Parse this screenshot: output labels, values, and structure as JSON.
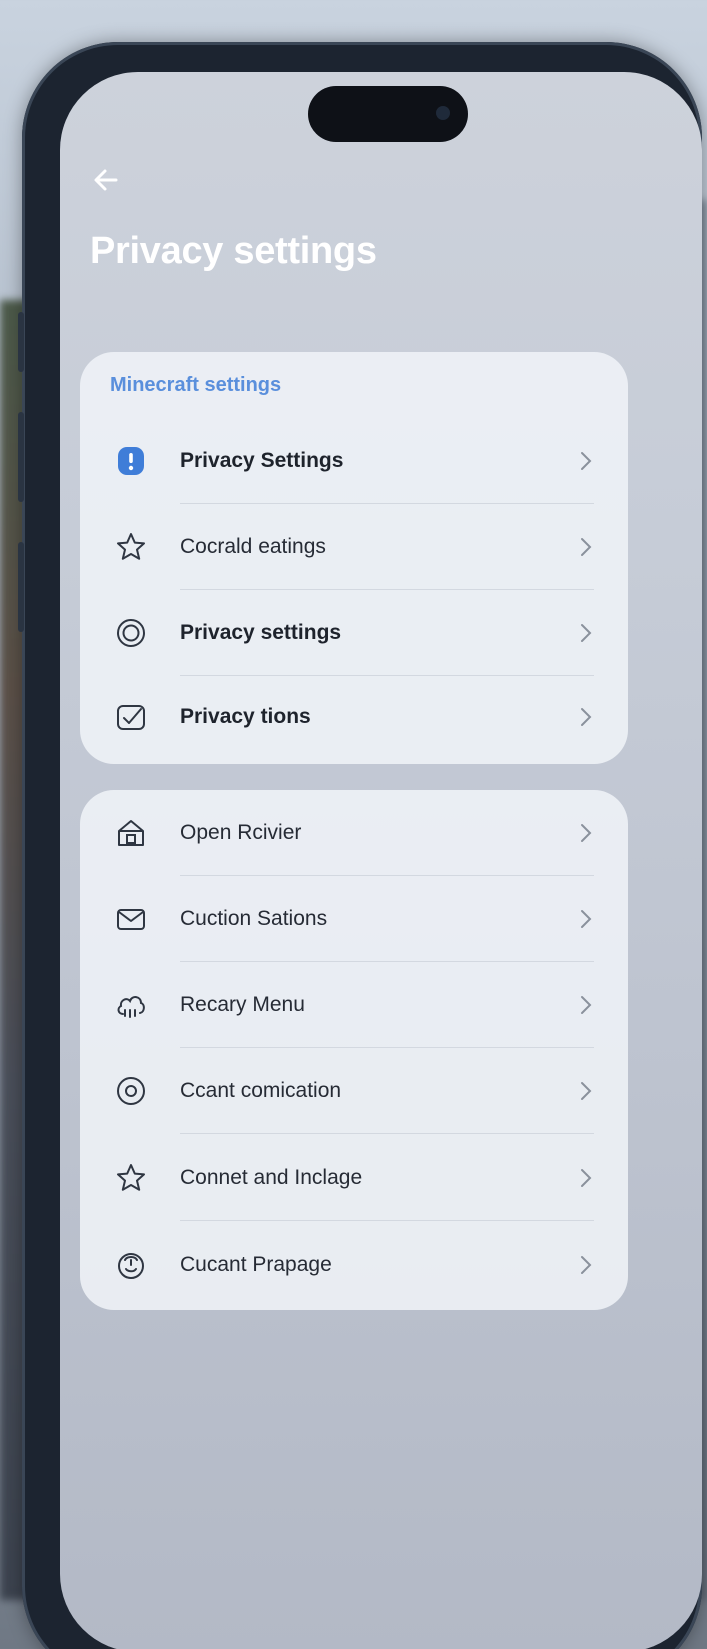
{
  "header": {
    "back_label": "←",
    "title": "Privacy settings"
  },
  "colors": {
    "accent": "#5a8fdc",
    "icon_stroke": "#2f3642",
    "icon_fill_active": "#3f7dd8"
  },
  "group1": {
    "section_title": "Minecraft settings",
    "items": [
      {
        "label": "Privacy Settings",
        "icon": "alert-shield-icon",
        "bold": true
      },
      {
        "label": "Cocrald eatings",
        "icon": "star-icon",
        "bold": false
      },
      {
        "label": "Privacy settings",
        "icon": "target-icon",
        "bold": true
      },
      {
        "label": "Privacy tions",
        "icon": "checkbox-icon",
        "bold": true
      }
    ]
  },
  "group2": {
    "items": [
      {
        "label": "Open Rcivier",
        "icon": "home-icon"
      },
      {
        "label": "Cuction Sations",
        "icon": "mail-icon"
      },
      {
        "label": "Recary Menu",
        "icon": "cloud-icon"
      },
      {
        "label": "Ccant comication",
        "icon": "circle-icon"
      },
      {
        "label": "Connet and Inclage",
        "icon": "star-icon"
      },
      {
        "label": "Cucant Prapage",
        "icon": "face-icon"
      }
    ]
  }
}
